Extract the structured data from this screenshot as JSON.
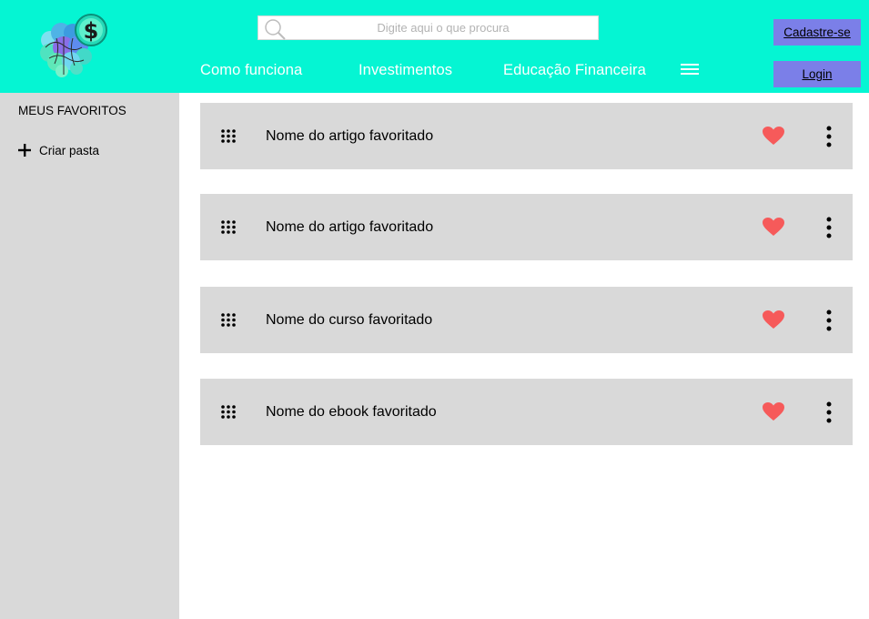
{
  "header": {
    "logo_icon": "brain-dollar-logo-icon",
    "search": {
      "placeholder": "Digite aqui o que procura",
      "value": "",
      "icon": "search-icon"
    },
    "nav": [
      {
        "label": "Como funciona"
      },
      {
        "label": "Investimentos"
      },
      {
        "label": "Educação Financeira"
      }
    ],
    "menu_icon": "hamburger-menu-icon",
    "signup_label": "Cadastre-se",
    "login_label": "Login"
  },
  "sidebar": {
    "title": "MEUS FAVORITOS",
    "create_folder_label": "Criar pasta",
    "create_folder_icon": "plus-icon"
  },
  "favorites": [
    {
      "title": "Nome do artigo favoritado"
    },
    {
      "title": "Nome do artigo favoritado"
    },
    {
      "title": "Nome do curso favoritado"
    },
    {
      "title": "Nome do ebook favoritado"
    }
  ],
  "colors": {
    "header_bg": "#05f5d3",
    "button_bg": "#7b7fe8",
    "panel_bg": "#d9d9d9",
    "heart": "#f65a5a"
  }
}
